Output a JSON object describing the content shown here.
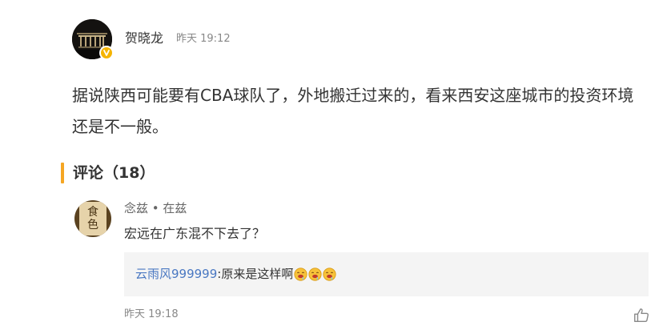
{
  "post": {
    "author": "贺晓龙",
    "time": "昨天 19:12",
    "text": "据说陕西可能要有CBA球队了，外地搬迁过来的，看来西安这座城市的投资环境还是不一般。",
    "avatar_icon": "dark-architecture-avatar",
    "verified_icon": "verified-badge-icon",
    "verified_color": "#f5b400"
  },
  "comments": {
    "title": "评论（18）",
    "accent_color": "#f5a623",
    "items": [
      {
        "name": "念兹 • 在兹",
        "avatar_chars": [
          "食",
          "色"
        ],
        "text": "宏远在广东混不下去了？",
        "reply": {
          "user": "云雨风999999",
          "separator": ":",
          "text": "原来是这样啊",
          "emoji_count": 3,
          "emoji_icon": "drooling-face-emoji"
        },
        "time": "昨天 19:18",
        "like_icon": "thumbs-up-icon"
      }
    ]
  },
  "colors": {
    "link": "#4a78c2",
    "secondary_text": "#888888",
    "reply_background": "#f4f4f4"
  }
}
